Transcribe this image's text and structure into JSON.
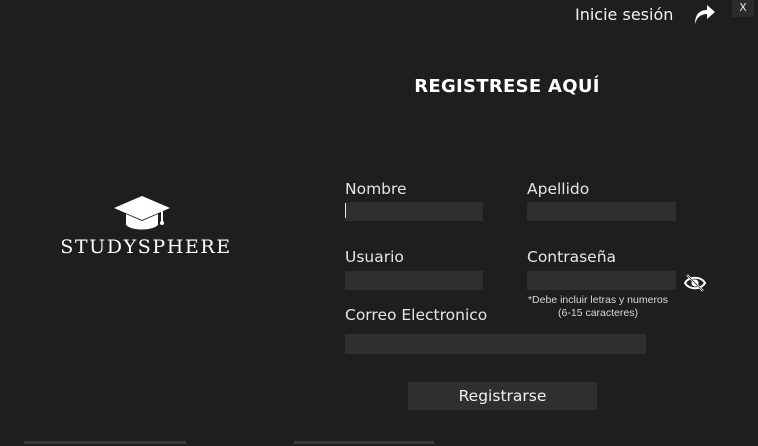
{
  "header": {
    "login_link": "Inicie sesión",
    "close_label": "X"
  },
  "title": "REGISTRESE AQUÍ",
  "logo": {
    "name": "STUDYSPHERE",
    "icon": "graduation-cap-icon"
  },
  "form": {
    "nombre": {
      "label": "Nombre",
      "value": ""
    },
    "apellido": {
      "label": "Apellido",
      "value": ""
    },
    "usuario": {
      "label": "Usuario",
      "value": ""
    },
    "contrasena": {
      "label": "Contraseña",
      "value": "",
      "hint_line1": "*Debe incluir letras y numeros",
      "hint_line2": "(6-15 caracteres)",
      "toggle_icon": "eye-slash-icon"
    },
    "correo": {
      "label": "Correo Electronico",
      "value": ""
    },
    "submit_label": "Registrarse"
  },
  "colors": {
    "background": "#1e1e1e",
    "input_bg": "#2f2f2f",
    "text": "#e6e6e6",
    "title": "#ffffff"
  }
}
